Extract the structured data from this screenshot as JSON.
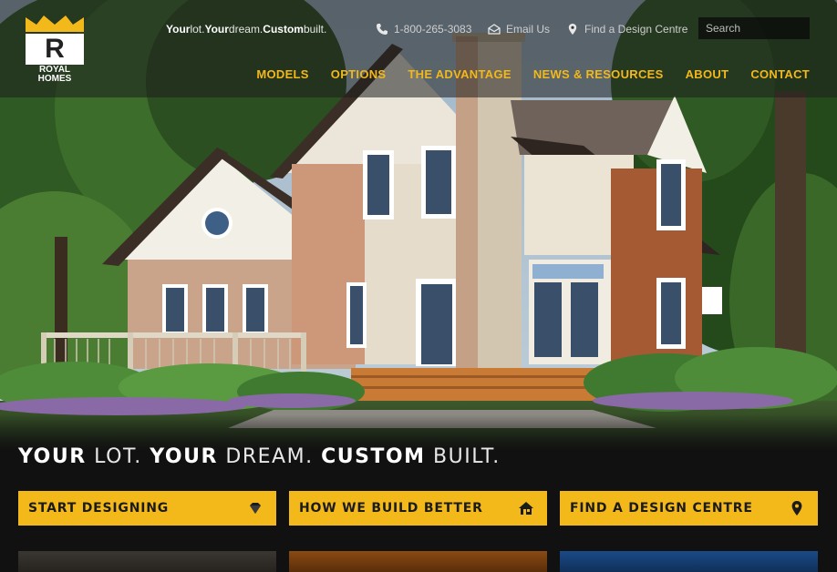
{
  "brand": {
    "name_line1": "ROYAL",
    "name_line2": "HOMES",
    "logo_letter": "R",
    "accent_color": "#f3b81a"
  },
  "utility_bar": {
    "tagline_parts": [
      "Your",
      " lot. ",
      "Your",
      " dream. ",
      "Custom",
      " built."
    ],
    "phone": "1-800-265-3083",
    "email_label": "Email Us",
    "find_label": "Find a Design Centre",
    "search_placeholder": "Search",
    "icons": [
      "phone-icon",
      "email-icon",
      "map-pin-icon",
      "search-icon"
    ]
  },
  "nav": {
    "items": [
      "MODELS",
      "OPTIONS",
      "THE ADVANTAGE",
      "NEWS & RESOURCES",
      "ABOUT",
      "CONTACT"
    ]
  },
  "hero": {
    "headline_parts": [
      "YOUR",
      " LOT. ",
      "YOUR",
      " DREAM. ",
      "CUSTOM",
      " BUILT."
    ]
  },
  "cta": {
    "items": [
      {
        "label": "START DESIGNING",
        "icon": "diamond-icon"
      },
      {
        "label": "HOW WE BUILD BETTER",
        "icon": "house-icon"
      },
      {
        "label": "FIND A DESIGN CENTRE",
        "icon": "map-pin-icon"
      }
    ]
  }
}
